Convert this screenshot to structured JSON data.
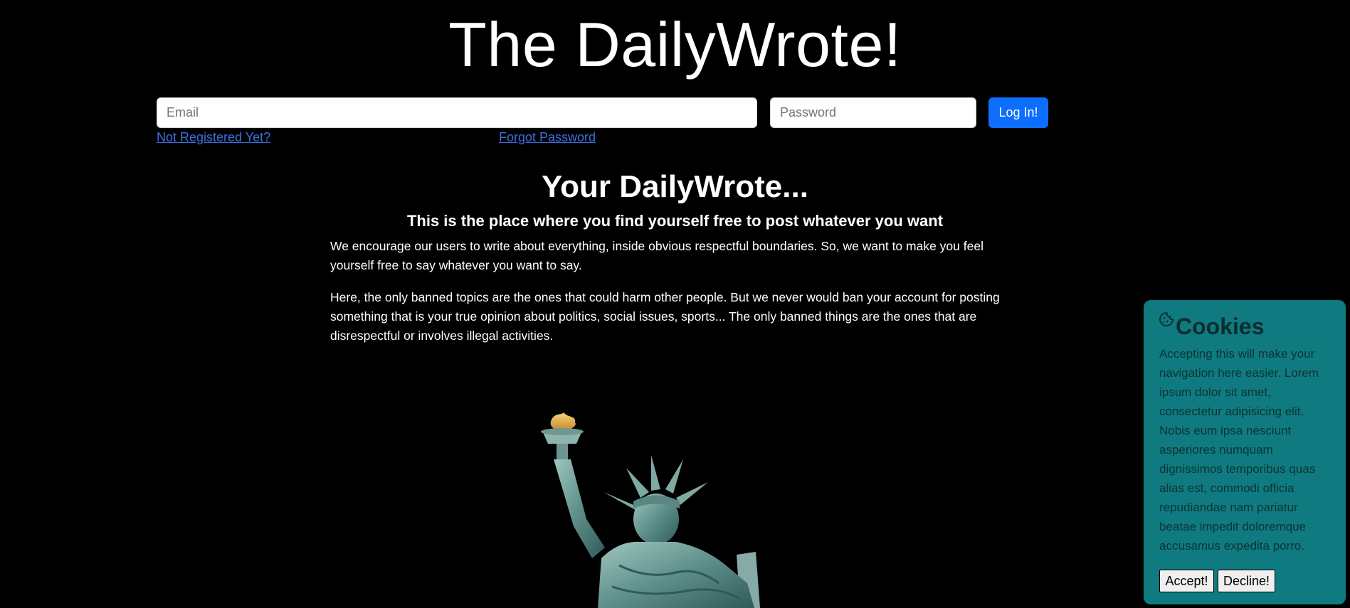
{
  "header": {
    "site_title": "The DailyWrote!"
  },
  "login": {
    "email_placeholder": "Email",
    "password_placeholder": "Password",
    "login_button": "Log In!",
    "register_link": "Not Registered Yet?",
    "forgot_link": "Forgot Password"
  },
  "hero": {
    "title": "Your DailyWrote...",
    "subtitle": "This is the place where you find yourself free to post whatever you want",
    "paragraph_1": "We encourage our users to write about everything, inside obvious respectful boundaries. So, we want to make you feel yourself free to say whatever you want to say.",
    "paragraph_2": "Here, the only banned topics are the ones that could harm other people. But we never would ban your account for posting something that is your true opinion about politics, social issues, sports... The only banned things are the ones that are disrespectful or involves illegal activities."
  },
  "cookies": {
    "title": "Cookies",
    "icon": "cookie-icon",
    "text": "Accepting this will make your navigation here easier. Lorem ipsum dolor sit amet, consectetur adipisicing elit. Nobis eum ipsa nesciunt asperiores numquam dignissimos temporibus quas alias est, commodi officia repudiandae nam pariatur beatae impedit doloremque accusamus expedita porro.",
    "accept_button": "Accept!",
    "decline_button": "Decline!"
  },
  "colors": {
    "background": "#000000",
    "primary_button": "#0d6efd",
    "link": "#3d6fe0",
    "cookie_panel": "#0f7a7f"
  }
}
